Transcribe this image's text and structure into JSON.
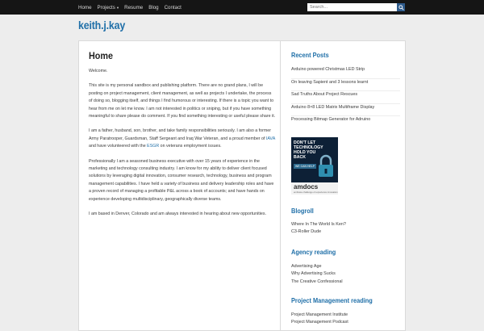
{
  "nav": {
    "items": [
      {
        "label": "Home"
      },
      {
        "label": "Projects",
        "has_dropdown": true
      },
      {
        "label": "Resume"
      },
      {
        "label": "Blog"
      },
      {
        "label": "Contact"
      }
    ],
    "search_placeholder": "Search..."
  },
  "site": {
    "title": "keith.j.kay"
  },
  "page": {
    "title": "Home",
    "paragraphs": {
      "p1": "Welcome.",
      "p2": "This site is my personal sandbox and publishing platform. There are no grand plans, I will be posting on project management, client management, as well as projects I undertake, the process of doing so, blogging itself, and things I find humorous or interesting. If there is a topic you want to hear from me on let me know. I am not interested in politics or sniping, but if you have something meaningful to share please do comment. If you find something interesting or useful please share it.",
      "p3_a": "I am a father, husband, son, brother, and take family responsibilities seriously. I am also a former Army Paratrooper, Guardsman, Staff Sergeant and Iraq War Veteran, and a proud member of ",
      "p3_link1": "IAVA",
      "p3_b": " and have volunteered with the ",
      "p3_link2": "ESGR",
      "p3_c": " on veterans employment issues.",
      "p4": "Professionally I am a seasoned business executive with over 15 years of experience in the marketing and technology consulting industry. I am know for my ability to deliver client focused solutions by leveraging digital innovation, consumer research, technology, business and program management capabilities. I have held a variety of business and delivery leadership roles and have a proven record of managing a profitable P&L across a book of accounts; and have hands on experience developing multidisciplinary, geographically diverse teams.",
      "p5": "I am based in Denver, Colorado and am always interested in hearing about new opportunities."
    }
  },
  "sidebar": {
    "recent_posts": {
      "heading": "Recent Posts",
      "items": [
        {
          "label": "Arduino powered Christmas LED Strip"
        },
        {
          "label": "On leaving Sapient and 3 lessons learnt"
        },
        {
          "label": "Sad Truths About Project Rescues"
        },
        {
          "label": "Arduino 8×8 LED Matrix Multiframe Display"
        },
        {
          "label": "Processing Bitmap Generator for Adruino"
        }
      ]
    },
    "ad": {
      "headline": "DON'T LET TECHNOLOGY HOLD YOU BACK",
      "cta": "WE CAN HELP",
      "brand": "amdocs",
      "tagline": "embrace challenge of experience innovation"
    },
    "blogroll": {
      "heading": "Blogroll",
      "items": [
        {
          "label": "Where In The World Is Ken?"
        },
        {
          "label": "C3-Roller Dude"
        }
      ]
    },
    "agency_reading": {
      "heading": "Agency reading",
      "items": [
        {
          "label": "Advertising Age"
        },
        {
          "label": "Why Advertising Sucks"
        },
        {
          "label": "The Creative Confessional"
        }
      ]
    },
    "pm_reading": {
      "heading": "Project Management reading",
      "items": [
        {
          "label": "Project Management Institute"
        },
        {
          "label": "Project Management Podcast"
        }
      ]
    }
  },
  "colors": {
    "topbar": "#151515",
    "accent": "#1f6fa8",
    "background": "#ededed",
    "search_button": "#2e5b8c"
  }
}
